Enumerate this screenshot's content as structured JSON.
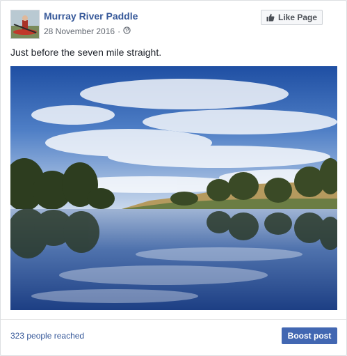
{
  "post": {
    "page_name": "Murray River Paddle",
    "date": "28 November 2016",
    "separator": "·",
    "audience_icon": "globe-icon",
    "text": "Just before the seven mile straight.",
    "photo_subject": "river-landscape-photo"
  },
  "actions": {
    "like_page_label": "Like Page",
    "like_icon": "thumbs-up-icon"
  },
  "footer": {
    "reach": "323 people reached",
    "boost_label": "Boost post"
  },
  "colors": {
    "link": "#365899",
    "boost": "#4267b2",
    "text": "#1d2129",
    "meta": "#616770"
  }
}
